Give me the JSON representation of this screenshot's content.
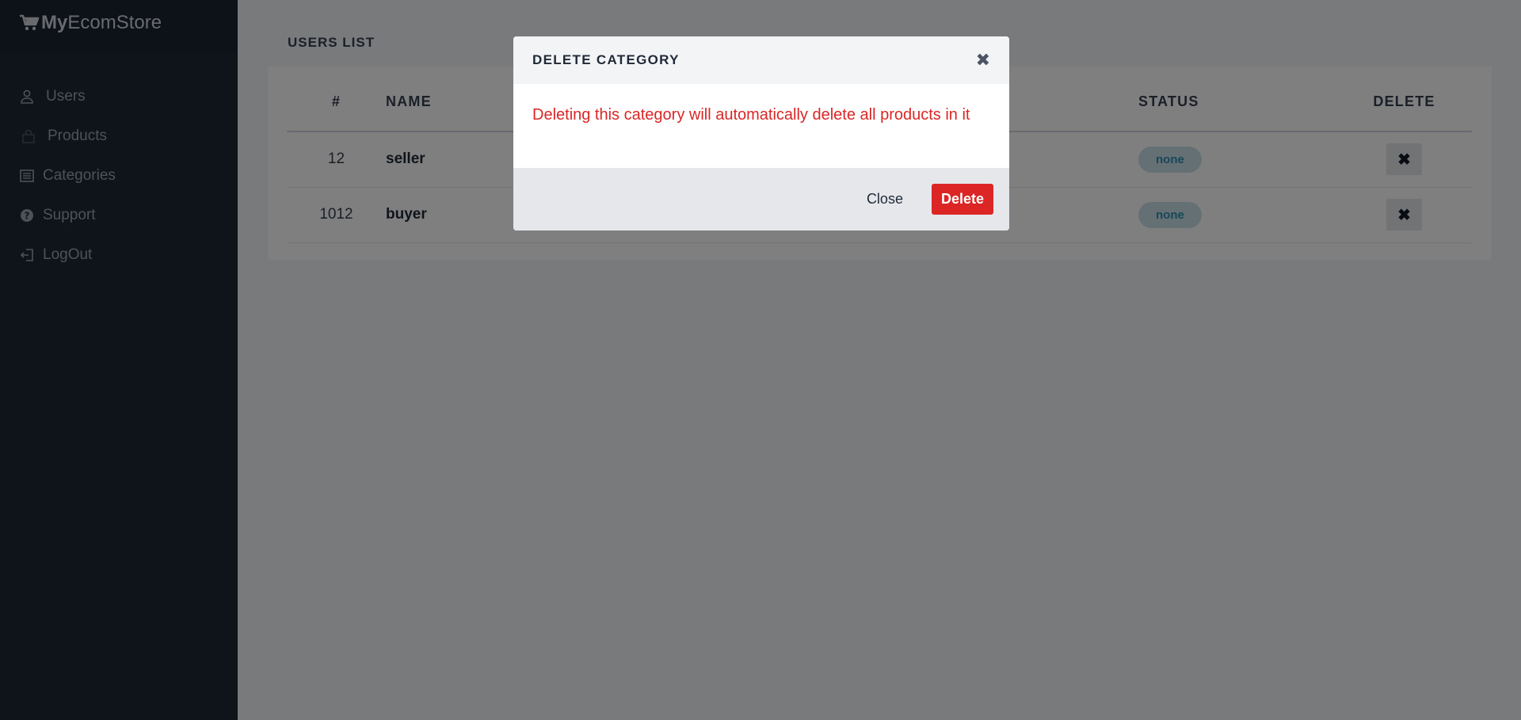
{
  "brand": {
    "bold": "My",
    "light": "EcomStore"
  },
  "sidebar": {
    "items": [
      {
        "label": "Users",
        "icon": "user-icon"
      },
      {
        "label": "Products",
        "icon": "bag-icon"
      },
      {
        "label": "Categories",
        "icon": "list-icon"
      },
      {
        "label": "Support",
        "icon": "question-icon"
      },
      {
        "label": "LogOut",
        "icon": "logout-icon"
      }
    ]
  },
  "main": {
    "card_title": "USERS LIST",
    "columns": [
      "#",
      "NAME",
      "STATUS",
      "DELETE"
    ],
    "rows": [
      {
        "id": "12",
        "name": "seller",
        "status": "none",
        "delete": "✖"
      },
      {
        "id": "1012",
        "name": "buyer",
        "status": "none",
        "delete": "✖"
      }
    ]
  },
  "modal": {
    "title": "DELETE CATEGORY",
    "close_x": "✖",
    "message": "Deleting this category will automatically delete all products in it",
    "close_label": "Close",
    "delete_label": "Delete"
  },
  "colors": {
    "sidebar_bg": "#1f2937",
    "danger": "#dc2626",
    "badge_bg": "#cbe1ea",
    "badge_text": "#2e8fb0"
  }
}
